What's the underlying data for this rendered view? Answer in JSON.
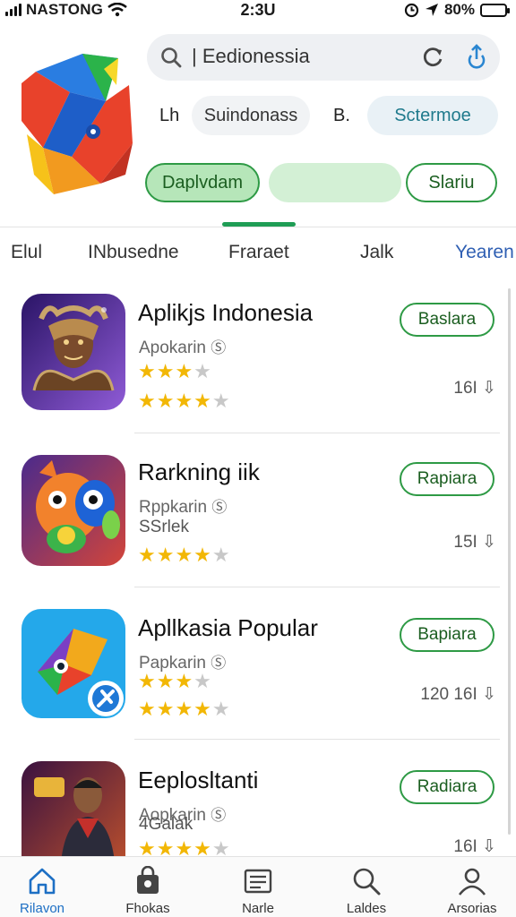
{
  "status_bar": {
    "carrier": "NASTONG",
    "time": "2:3U",
    "battery": "80%",
    "battery_level": 0.8
  },
  "search": {
    "query": "Eedionessia",
    "icons": [
      "search-icon",
      "refresh-icon",
      "share-icon"
    ]
  },
  "filters": {
    "label_left": "Lh",
    "chip_left": "Suindonass",
    "label_right": "B.",
    "chip_right": "Sctermoe"
  },
  "buttons": {
    "primary": "Daplvdam",
    "secondary": "",
    "outline": "Slariu"
  },
  "tabs": [
    "Elul",
    "INbusedne",
    "Fraraet",
    "Jalk",
    "Yearen"
  ],
  "active_tab_index": 4,
  "apps": [
    {
      "title": "Aplikjs Indonesia",
      "subtitle": "Apokarin",
      "extra": "",
      "ratings": [
        3,
        4
      ],
      "action": "Baslara",
      "meta": "16I",
      "colors": [
        "#3b1e7a",
        "#8f5bd6"
      ]
    },
    {
      "title": "Rarkning iik",
      "subtitle": "Rppkarin",
      "extra": "SSrlek",
      "ratings": [
        4
      ],
      "action": "Rapiara",
      "meta": "15I",
      "colors": [
        "#4a2a8c",
        "#e0612a"
      ]
    },
    {
      "title": "Apllkasia Popular",
      "subtitle": "Papkarin",
      "extra": "",
      "ratings": [
        3,
        4
      ],
      "action": "Bapiara",
      "meta": "120 16I",
      "colors": [
        "#22a7e8",
        "#3ac1f0"
      ]
    },
    {
      "title": "Eeplosltanti",
      "subtitle": "Aopkarin",
      "extra": "4Galak",
      "ratings": [
        4
      ],
      "action": "Radiara",
      "meta": "16I",
      "colors": [
        "#3a1240",
        "#c0522c"
      ]
    }
  ],
  "bottom_nav": [
    {
      "label": "Rilavon",
      "icon": "home-icon"
    },
    {
      "label": "Fhokas",
      "icon": "shopping-bag-icon"
    },
    {
      "label": "Narle",
      "icon": "document-icon"
    },
    {
      "label": "Laldes",
      "icon": "search-icon"
    },
    {
      "label": "Arsorias",
      "icon": "profile-icon"
    }
  ],
  "colors": {
    "accent_green": "#2e9a45",
    "tab_active": "#2f5fb3",
    "star": "#f2b705",
    "nav_active": "#1d6fc4"
  }
}
